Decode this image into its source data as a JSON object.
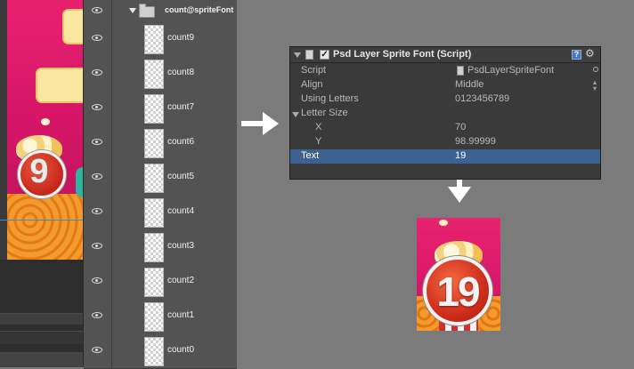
{
  "canvas_preview": {
    "digit": "9"
  },
  "layers": {
    "group": {
      "name": "count@spriteFont"
    },
    "items": [
      {
        "name": "count9"
      },
      {
        "name": "count8"
      },
      {
        "name": "count7"
      },
      {
        "name": "count6"
      },
      {
        "name": "count5"
      },
      {
        "name": "count4"
      },
      {
        "name": "count3"
      },
      {
        "name": "count2"
      },
      {
        "name": "count1"
      },
      {
        "name": "count0"
      }
    ]
  },
  "inspector": {
    "title": "Psd Layer Sprite Font (Script)",
    "enabled": true,
    "properties": {
      "script": {
        "label": "Script",
        "value": "PsdLayerSpriteFont"
      },
      "align": {
        "label": "Align",
        "value": "Middle"
      },
      "using_letters": {
        "label": "Using Letters",
        "value": "0123456789"
      },
      "letter_size": {
        "label": "Letter Size"
      },
      "x": {
        "label": "X",
        "value": "70"
      },
      "y": {
        "label": "Y",
        "value": "98.99999"
      },
      "text": {
        "label": "Text",
        "value": "19"
      }
    }
  },
  "result_preview": {
    "digit": "19"
  },
  "colors": {
    "panel_bg": "#535353",
    "inspector_bg": "#3a3a3a",
    "selected_row": "#3d6291",
    "canvas_pink": "#d61568",
    "badge_red": "#cf2d1c"
  },
  "icons": [
    "eye-icon",
    "folder-icon",
    "script-icon",
    "help-icon",
    "gear-icon",
    "arrow-right-icon",
    "arrow-down-icon"
  ]
}
